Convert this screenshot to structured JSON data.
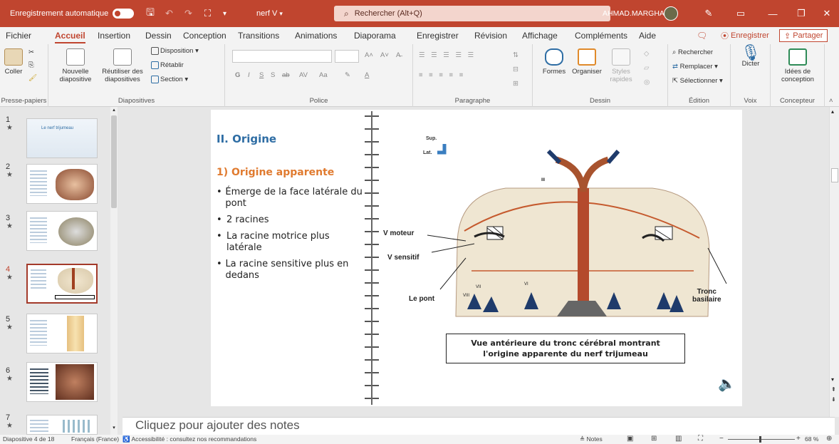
{
  "titlebar": {
    "autosave": "Enregistrement automatique",
    "filename": "nerf V",
    "search_placeholder": "Rechercher (Alt+Q)",
    "user": "AHMAD.MARGHADI"
  },
  "menu": {
    "tabs": [
      "Fichier",
      "Accueil",
      "Insertion",
      "Dessin",
      "Conception",
      "Transitions",
      "Animations",
      "Diaporama",
      "Enregistrer",
      "Révision",
      "Affichage",
      "Compléments",
      "Aide"
    ],
    "record": "Enregistrer",
    "share": "Partager"
  },
  "ribbon": {
    "clipboard": {
      "paste": "Coller",
      "label": "Presse-papiers"
    },
    "slides": {
      "new": "Nouvelle diapositive",
      "reuse": "Réutiliser des diapositives",
      "layout": "Disposition",
      "reset": "Rétablir",
      "section": "Section",
      "label": "Diapositives"
    },
    "font": {
      "label": "Police"
    },
    "paragraph": {
      "label": "Paragraphe"
    },
    "drawing": {
      "shapes": "Formes",
      "arrange": "Organiser",
      "styles": "Styles rapides",
      "label": "Dessin"
    },
    "editing": {
      "find": "Rechercher",
      "replace": "Remplacer",
      "select": "Sélectionner",
      "label": "Édition"
    },
    "voice": {
      "dictate": "Dicter",
      "label": "Voix"
    },
    "designer": {
      "ideas": "Idées de conception",
      "label": "Concepteur"
    }
  },
  "thumbnails": [
    {
      "num": "1",
      "star": "★",
      "caption": "Le nerf trijumeau"
    },
    {
      "num": "2",
      "star": "★"
    },
    {
      "num": "3",
      "star": "★"
    },
    {
      "num": "4",
      "star": "★"
    },
    {
      "num": "5",
      "star": "★"
    },
    {
      "num": "6",
      "star": "★"
    },
    {
      "num": "7",
      "star": "★"
    }
  ],
  "slide": {
    "heading": "II. Origine",
    "subheading": "1) Origine apparente",
    "bullets": [
      "Émerge de la face latérale du pont",
      "2 racines",
      "La racine motrice plus latérale",
      "La racine sensitive plus en dedans"
    ],
    "figure": {
      "sup": "Sup.",
      "lat": "Lat.",
      "v_moteur": "V moteur",
      "v_sensitif": "V sensitif",
      "le_pont": "Le pont",
      "tronc": "Tronc",
      "basilaire": "basilaire",
      "iii": "III",
      "vi": "VI",
      "vii": "VII",
      "viii": "VIII"
    },
    "caption_line1": "Vue antérieure du tronc cérébral montrant",
    "caption_line2": "l'origine apparente du nerf trijumeau"
  },
  "notes_placeholder": "Cliquez pour ajouter des notes",
  "status": {
    "slide_of": "Diapositive 4 de 18",
    "language": "Français (France)",
    "accessibility": "Accessibilité : consultez nos recommandations",
    "notes": "Notes",
    "zoom": "68 %"
  },
  "colors": {
    "accent": "#c0452f",
    "heading_blue": "#2e6da4",
    "subheading_orange": "#e07b30"
  }
}
